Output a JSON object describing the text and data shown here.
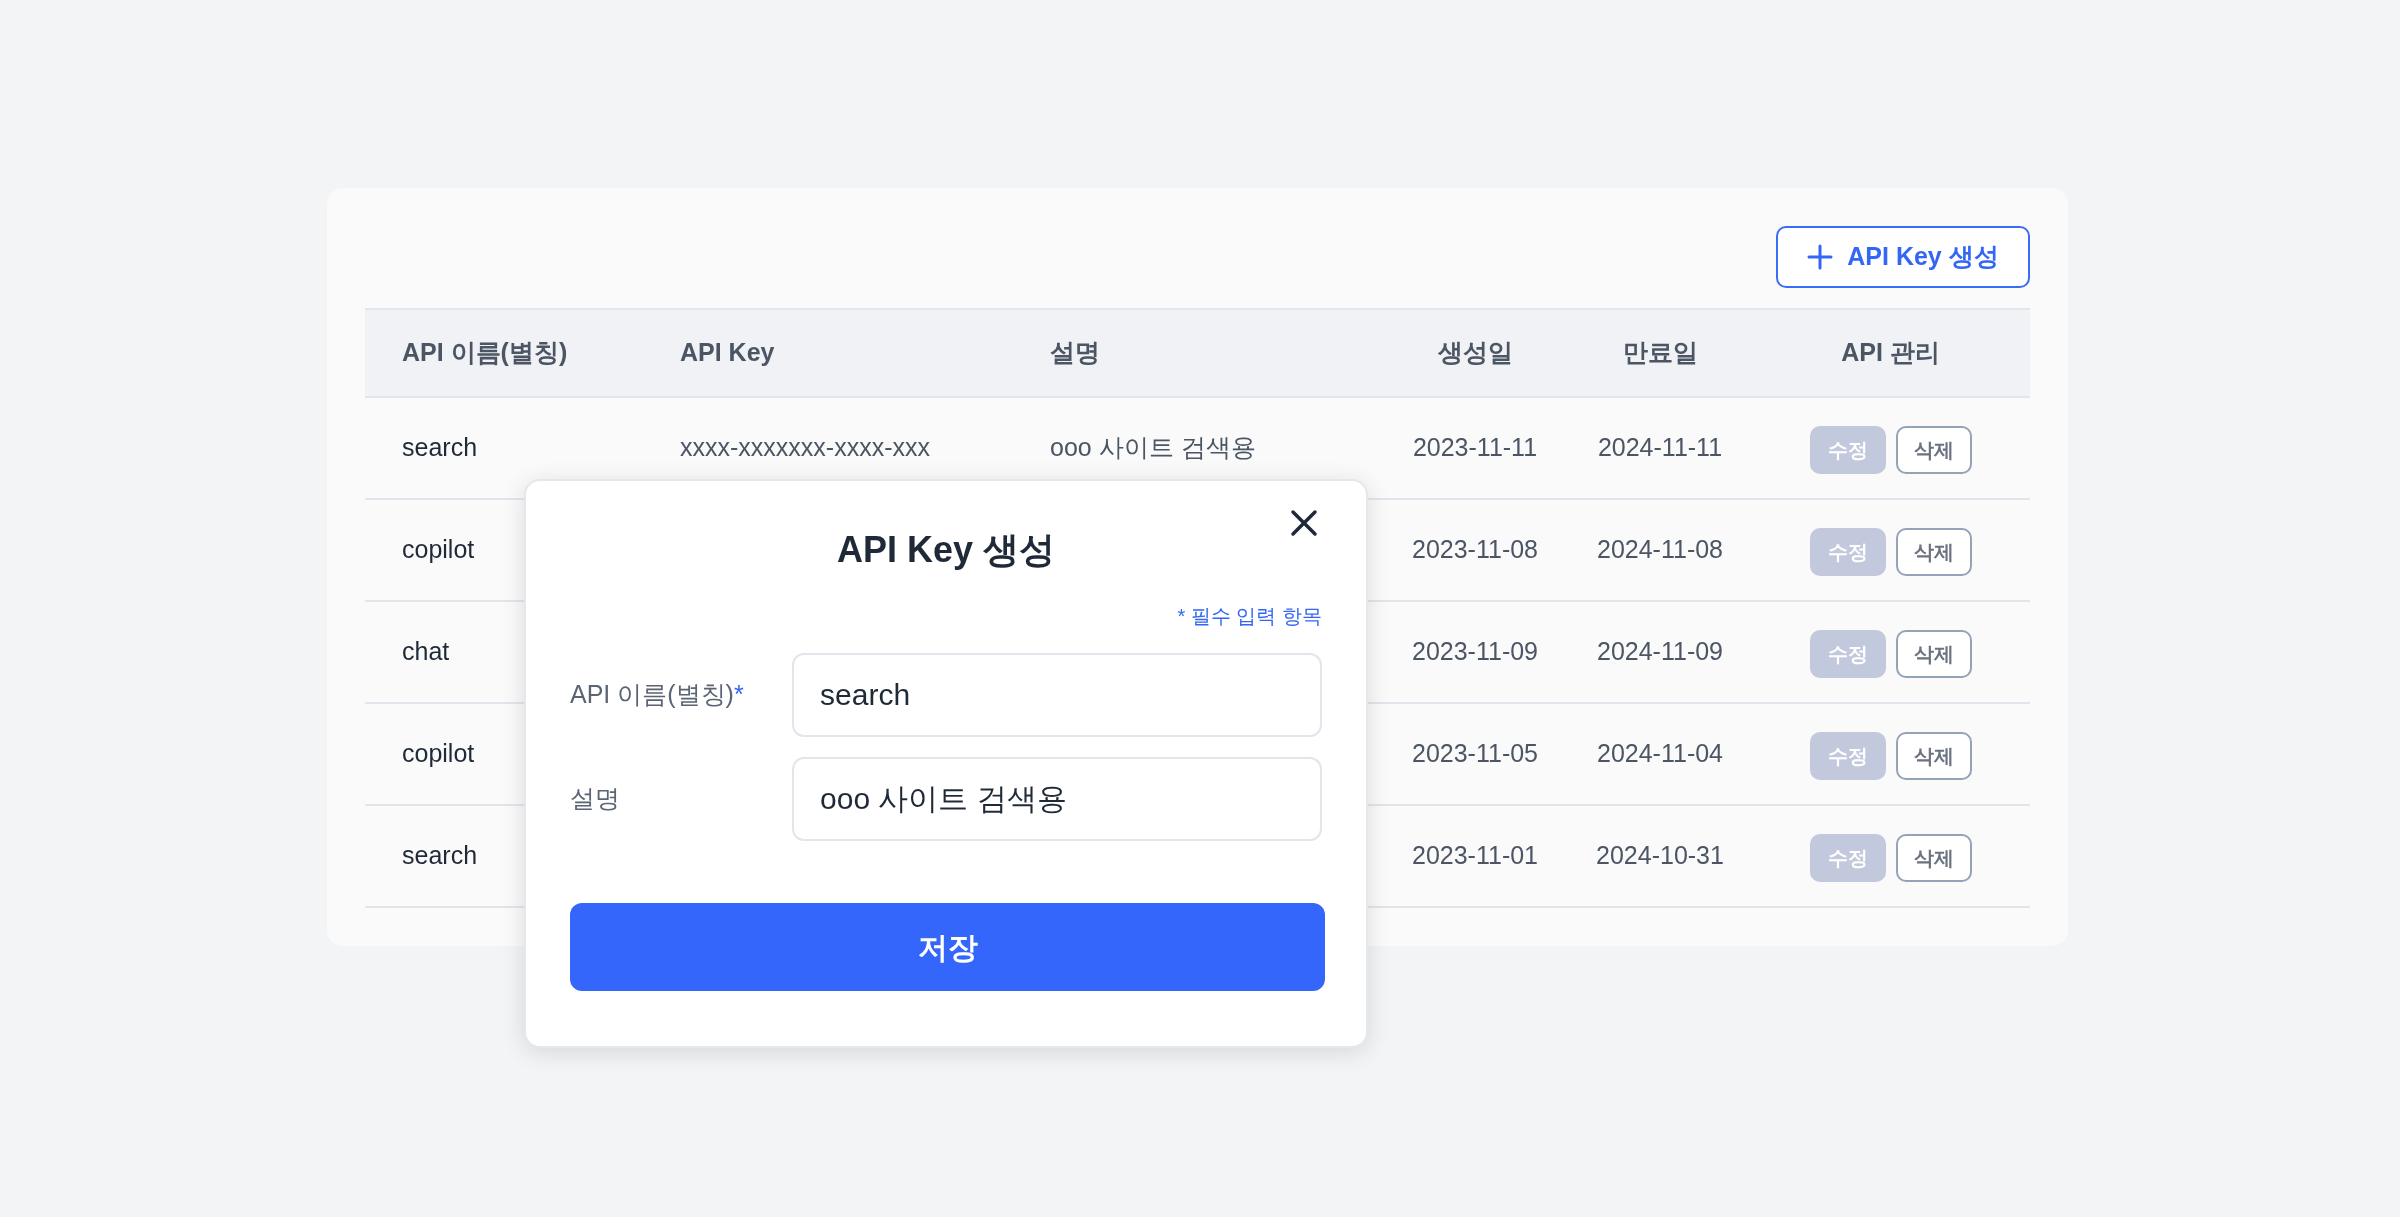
{
  "create_button": {
    "label": "API Key 생성"
  },
  "table": {
    "columns": [
      "API 이름(별칭)",
      "API Key",
      "설명",
      "생성일",
      "만료일",
      "API 관리"
    ],
    "rows": [
      {
        "name": "search",
        "api_key": "xxxx-xxxxxxx-xxxx-xxx",
        "description": "ooo 사이트 검색용",
        "created": "2023-11-11",
        "expires": "2024-11-11",
        "actions": [
          "수정",
          "삭제"
        ]
      },
      {
        "name": "copilot",
        "created": "2023-11-08",
        "expires": "2024-11-08",
        "actions": [
          "수정",
          "삭제"
        ]
      },
      {
        "name": "chat",
        "created": "2023-11-09",
        "expires": "2024-11-09",
        "actions": [
          "수정",
          "삭제"
        ]
      },
      {
        "name": "copilot",
        "created": "2023-11-05",
        "expires": "2024-11-04",
        "actions": [
          "수정",
          "삭제"
        ]
      },
      {
        "name": "search",
        "created": "2023-11-01",
        "expires": "2024-10-31",
        "actions": [
          "수정",
          "삭제"
        ]
      }
    ]
  },
  "modal": {
    "title": "API Key 생성",
    "required_note": "* 필수 입력 항목",
    "required_mark": "*",
    "fields": [
      {
        "label": "API 이름(별칭)",
        "required": true,
        "value": "search"
      },
      {
        "label": "설명",
        "required": false,
        "value": "ooo 사이트 검색용"
      }
    ],
    "save_button": "저장"
  }
}
